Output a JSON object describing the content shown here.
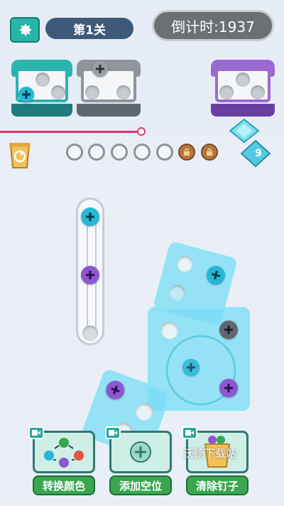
{
  "header": {
    "level_label": "第1关",
    "timer_text": "倒计时:1937"
  },
  "boxes": [
    {
      "color": "#2bb4b0",
      "state": "one screw filled"
    },
    {
      "color": "#8e969b",
      "state": "one screw filled"
    },
    {
      "color": "#9a6ad1",
      "state": "empty"
    }
  ],
  "progress": {
    "fraction": 0.5
  },
  "holder_slots": {
    "total": 7,
    "locked": 2
  },
  "gems": {
    "count": "9"
  },
  "tools": [
    {
      "label": "转换颜色"
    },
    {
      "label": "添加空位"
    },
    {
      "label": "清除钉子"
    }
  ],
  "watermark": "沃德下载站",
  "colors": {
    "cyan_screw": "#25b7d6",
    "purple_screw": "#8d58cf",
    "gray_screw": "#5f6770",
    "green_screw": "#36a84b",
    "red_screw": "#e2543f",
    "plate": "#7fd9f0",
    "timer_bg": "#6b7073",
    "level_bg": "#3d5a78",
    "progress": "#e0366e"
  }
}
